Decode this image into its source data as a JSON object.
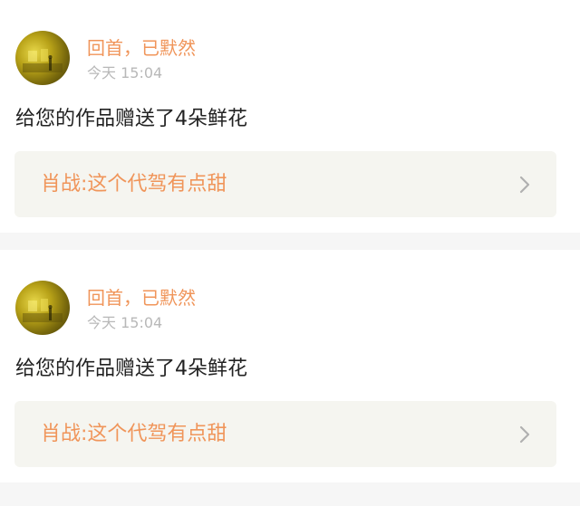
{
  "notifications": [
    {
      "username": "回首，已默然",
      "timestamp": "今天 15:04",
      "message": "给您的作品赠送了4朵鲜花",
      "work_title": "肖战:这个代驾有点甜"
    },
    {
      "username": "回首，已默然",
      "timestamp": "今天 15:04",
      "message": "给您的作品赠送了4朵鲜花",
      "work_title": "肖战:这个代驾有点甜"
    }
  ],
  "icons": {
    "avatar": "avatar-image",
    "chevron": "chevron-right-icon"
  },
  "colors": {
    "accent": "#f0955a",
    "timestamp": "#b8b8b8",
    "text": "#222222",
    "link_background": "#f5f5f0",
    "page_background": "#f6f6f6",
    "chevron": "#b0b0b0"
  }
}
